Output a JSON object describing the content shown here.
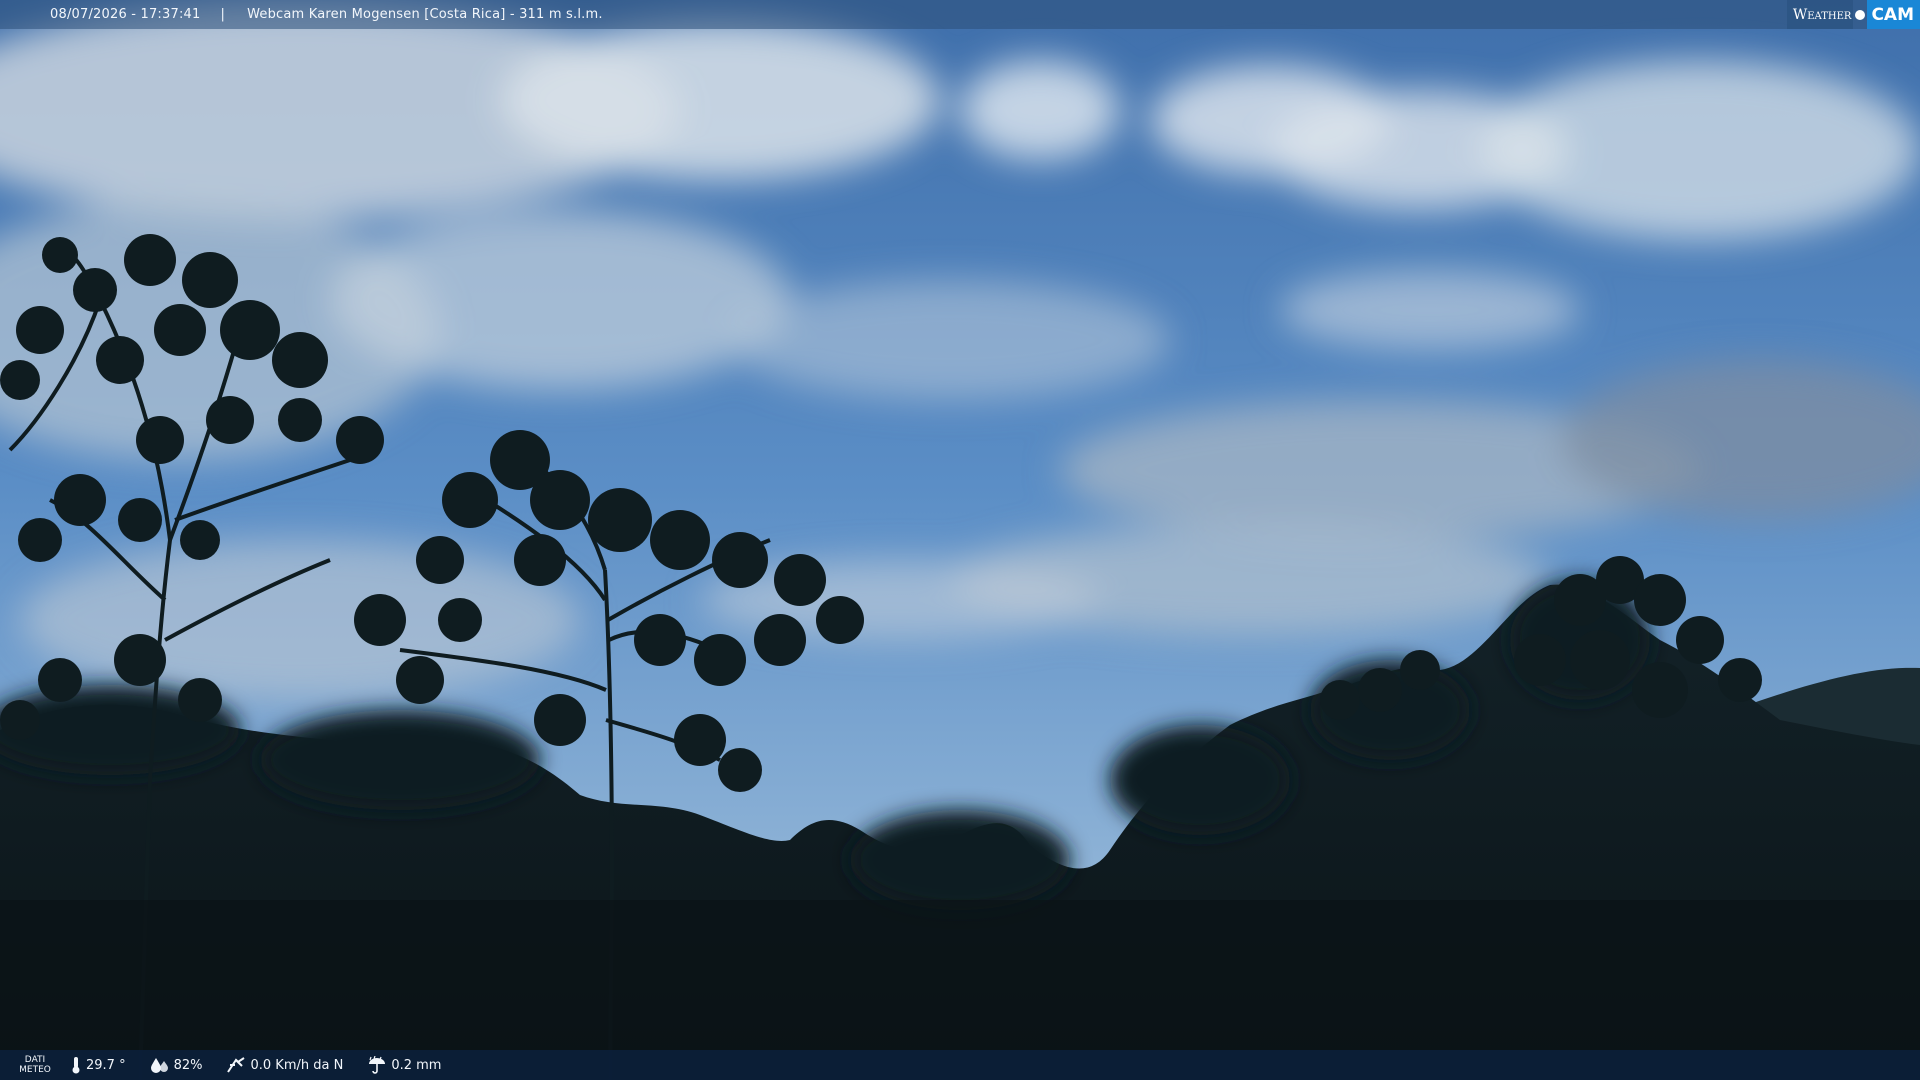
{
  "overlay": {
    "datetime": "08/07/2026 - 17:37:41",
    "separator": "|",
    "location": "Webcam Karen Mogensen [Costa Rica] - 311 m s.l.m."
  },
  "brand": {
    "weather": "Weather",
    "cam": "CAM",
    "accent_color": "#1a87d6"
  },
  "meteo": {
    "label_line1": "DATI",
    "label_line2": "METEO",
    "temperature": "29.7 °",
    "humidity": "82%",
    "wind": "0.0 Km/h da N",
    "rain": "0.2 mm",
    "icons": [
      "thermometer-icon",
      "humidity-drops-icon",
      "wind-icon",
      "rain-umbrella-icon"
    ]
  },
  "colors": {
    "sky_top": "#3e70ad",
    "sky_horizon": "#8fb4d8",
    "vegetation": "#0f1c20"
  }
}
